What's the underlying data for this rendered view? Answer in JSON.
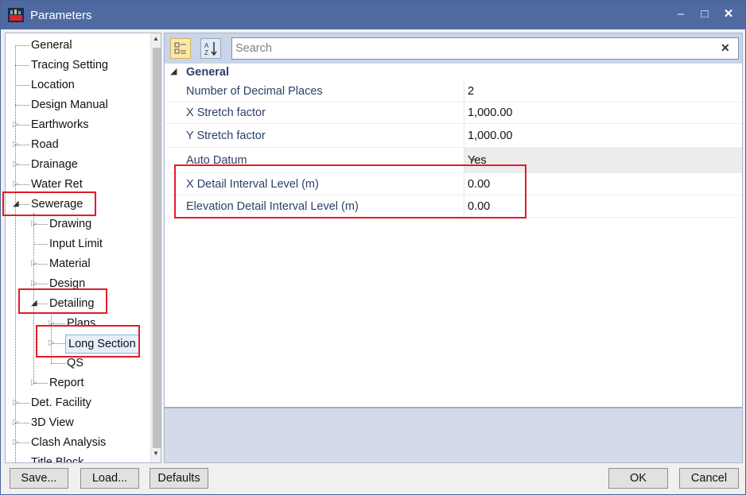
{
  "window": {
    "title": "Parameters",
    "app_icon": "app-logo-icon",
    "minimize": "–",
    "maximize": "□",
    "close": "✕"
  },
  "tree": {
    "items": [
      {
        "label": "General",
        "level": 0,
        "expander": "none"
      },
      {
        "label": "Tracing Setting",
        "level": 0,
        "expander": "none"
      },
      {
        "label": "Location",
        "level": 0,
        "expander": "none"
      },
      {
        "label": "Design Manual",
        "level": 0,
        "expander": "none"
      },
      {
        "label": "Earthworks",
        "level": 0,
        "expander": "closed"
      },
      {
        "label": "Road",
        "level": 0,
        "expander": "closed"
      },
      {
        "label": "Drainage",
        "level": 0,
        "expander": "closed"
      },
      {
        "label": "Water Ret",
        "level": 0,
        "expander": "closed"
      },
      {
        "label": "Sewerage",
        "level": 0,
        "expander": "open"
      },
      {
        "label": "Drawing",
        "level": 1,
        "expander": "closed"
      },
      {
        "label": "Input Limit",
        "level": 1,
        "expander": "none"
      },
      {
        "label": "Material",
        "level": 1,
        "expander": "closed"
      },
      {
        "label": "Design",
        "level": 1,
        "expander": "closed"
      },
      {
        "label": "Detailing",
        "level": 1,
        "expander": "open"
      },
      {
        "label": "Plans",
        "level": 2,
        "expander": "closed"
      },
      {
        "label": "Long Section",
        "level": 2,
        "expander": "closed",
        "selected": true
      },
      {
        "label": "QS",
        "level": 2,
        "expander": "none"
      },
      {
        "label": "Report",
        "level": 1,
        "expander": "closed"
      },
      {
        "label": "Det. Facility",
        "level": 0,
        "expander": "closed"
      },
      {
        "label": "3D View",
        "level": 0,
        "expander": "closed"
      },
      {
        "label": "Clash Analysis",
        "level": 0,
        "expander": "closed"
      },
      {
        "label": "Title Block",
        "level": 0,
        "expander": "none"
      }
    ]
  },
  "toolbar": {
    "categorized_icon": "categorized-view-icon",
    "sort_icon": "sort-alphabetical-icon",
    "sort_glyph": "A↓Z"
  },
  "search": {
    "placeholder": "Search",
    "value": "",
    "clear": "✕"
  },
  "grid": {
    "category": "General",
    "properties": [
      {
        "name": "Number of Decimal Places",
        "value": "2"
      },
      {
        "name": "X Stretch factor",
        "value": "1,000.00"
      },
      {
        "name": "Y Stretch factor",
        "value": "1,000.00"
      },
      {
        "name": "Auto Datum",
        "value": "Yes",
        "dropdown": true
      },
      {
        "name": "X Detail Interval Level (m)",
        "value": "0.00"
      },
      {
        "name": "Elevation Detail Interval Level (m)",
        "value": "0.00"
      }
    ]
  },
  "buttons": {
    "save": "Save...",
    "load": "Load...",
    "defaults": "Defaults",
    "ok": "OK",
    "cancel": "Cancel"
  },
  "colors": {
    "title_bar": "#4e6aa1",
    "highlight": "#e21b2a",
    "property_text": "#2b3f6b",
    "toolbar": "#c9d5e8"
  }
}
